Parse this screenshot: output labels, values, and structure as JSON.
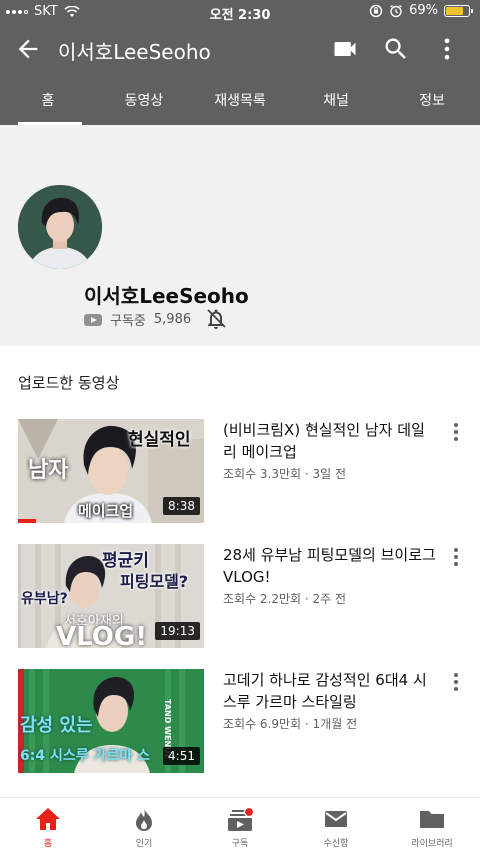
{
  "status_bar": {
    "carrier": "SKT",
    "time": "오전 2:30",
    "battery": "69%",
    "battery_level": 0.69
  },
  "header": {
    "title": "이서호LeeSeoho",
    "icons": [
      "back-arrow-icon",
      "video-camera-icon",
      "search-icon",
      "more-vert-icon"
    ]
  },
  "tabs": [
    {
      "label": "홈",
      "active": true
    },
    {
      "label": "동영상",
      "active": false
    },
    {
      "label": "재생목록",
      "active": false
    },
    {
      "label": "채널",
      "active": false
    },
    {
      "label": "정보",
      "active": false
    }
  ],
  "channel": {
    "name": "이서호LeeSeoho",
    "subscribe_label": "구독중",
    "subscriber_count": "5,986"
  },
  "section": {
    "title": "업로드한 동영상"
  },
  "videos": [
    {
      "title": "(비비크림X) 현실적인 남자 데일리 메이크업",
      "meta": "조회수 3.3만회 · 3일 전",
      "duration": "8:38",
      "thumb_text": [
        "현실적인",
        "남자",
        "메이크업"
      ]
    },
    {
      "title": "28세 유부남 피팅모델의 브이로그VLOG!",
      "meta": "조회수 2.2만회 · 2주 전",
      "duration": "19:13",
      "thumb_text": [
        "평균키",
        "피팅모델?",
        "유부남?",
        "서호아재의",
        "VLOG!"
      ]
    },
    {
      "title": "고데기 하나로 감성적인 6대4 시스루 가르마 스타일링",
      "meta": "조회수 6.9만회 · 1개월 전",
      "duration": "4:51",
      "thumb_text": [
        "감성 있는",
        "6:4 시스루 가르마 스",
        "TAND WENUE"
      ]
    }
  ],
  "bottom_nav": [
    {
      "label": "홈",
      "active": true
    },
    {
      "label": "인기",
      "active": false
    },
    {
      "label": "구독",
      "active": false
    },
    {
      "label": "수신함",
      "active": false
    },
    {
      "label": "라이브러리",
      "active": false
    }
  ],
  "colors": {
    "header_bg": "#606060",
    "accent_red": "#e62117",
    "channel_bg": "#f1f1f1"
  }
}
